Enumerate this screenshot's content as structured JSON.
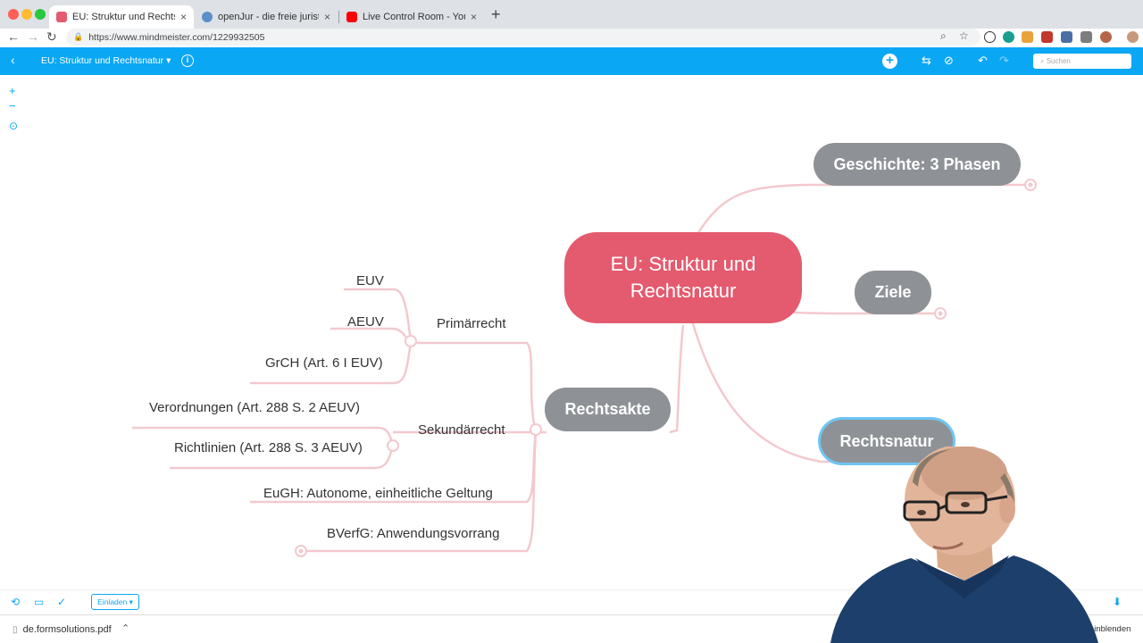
{
  "browser": {
    "tabs": [
      {
        "title": "EU: Struktur und Rechtsnatur",
        "active": true,
        "icon": "mindmeister-icon"
      },
      {
        "title": "openJur - die freie juristische D",
        "active": false,
        "icon": "openjur-icon"
      },
      {
        "title": "Live Control Room - YouTube",
        "active": false,
        "icon": "youtube-icon"
      }
    ],
    "url": "https://www.mindmeister.com/1229932505"
  },
  "app": {
    "map_title": "EU: Struktur und Rechtsnatur",
    "search_placeholder": "Suchen",
    "accent": "#0aa7f5"
  },
  "mindmap": {
    "root": {
      "line1": "EU: Struktur und",
      "line2": "Rechtsnatur",
      "color": "#e45a6e"
    },
    "main_topics": {
      "geschichte": "Geschichte: 3 Phasen",
      "ziele": "Ziele",
      "rechtsakte": "Rechtsakte",
      "rechtsnatur": "Rechtsnatur"
    },
    "rechtsakte_children": {
      "primaerrecht": "Primärrecht",
      "sekundaerrecht": "Sekundärrecht",
      "eugh": "EuGH: Autonome, einheitliche Geltung",
      "bverfg": "BVerfG: Anwendungsvorrang"
    },
    "primaerrecht_children": [
      "EUV",
      "AEUV",
      "GrCH (Art. 6 I EUV)"
    ],
    "sekundaerrecht_children": [
      "Verordnungen (Art. 288 S. 2 AEUV)",
      "Richtlinien (Art. 288 S. 3 AEUV)"
    ],
    "node_color": "#8e9296",
    "connector_color": "#f2c9cf"
  },
  "footer": {
    "invite_label": "Einladen ▾"
  },
  "downloads": {
    "file": "de.formsolutions.pdf",
    "show_all": "e einblenden"
  }
}
